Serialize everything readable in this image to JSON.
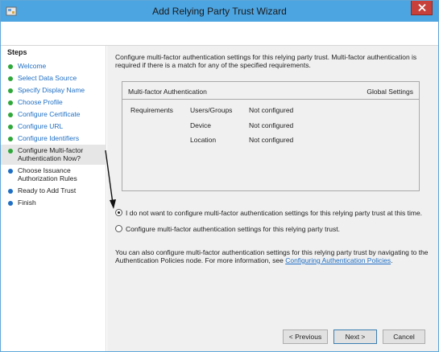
{
  "window": {
    "title": "Add Relying Party Trust Wizard"
  },
  "steps": {
    "heading": "Steps",
    "items": [
      {
        "label": "Welcome",
        "state": "done"
      },
      {
        "label": "Select Data Source",
        "state": "done"
      },
      {
        "label": "Specify Display Name",
        "state": "done"
      },
      {
        "label": "Choose Profile",
        "state": "done"
      },
      {
        "label": "Configure Certificate",
        "state": "done"
      },
      {
        "label": "Configure URL",
        "state": "done"
      },
      {
        "label": "Configure Identifiers",
        "state": "done"
      },
      {
        "label": "Configure Multi-factor Authentication Now?",
        "state": "current"
      },
      {
        "label": "Choose Issuance Authorization Rules",
        "state": "pending"
      },
      {
        "label": "Ready to Add Trust",
        "state": "pending"
      },
      {
        "label": "Finish",
        "state": "pending"
      }
    ]
  },
  "content": {
    "intro": "Configure multi-factor authentication settings for this relying party trust. Multi-factor authentication is required if there is a match for any of the specified requirements.",
    "mfa_box": {
      "title": "Multi-factor Authentication",
      "global_settings": "Global Settings",
      "requirements_label": "Requirements",
      "rows": [
        {
          "key": "Users/Groups",
          "value": "Not configured"
        },
        {
          "key": "Device",
          "value": "Not configured"
        },
        {
          "key": "Location",
          "value": "Not configured"
        }
      ]
    },
    "options": {
      "no_configure": "I do not want to configure multi-factor authentication settings for this relying party trust at this time.",
      "configure": "Configure multi-factor authentication settings for this relying party trust.",
      "selected": "no_configure"
    },
    "note_text": "You can also configure multi-factor authentication settings for this relying party trust by navigating to the Authentication Policies node. For more information, see ",
    "note_link": "Configuring Authentication Policies",
    "note_end": "."
  },
  "buttons": {
    "previous": "< Previous",
    "next": "Next >",
    "cancel": "Cancel"
  },
  "colors": {
    "titlebar": "#4ca4e0",
    "link": "#1f6fc4",
    "done_dot": "#2fa83a",
    "close": "#c7413a"
  }
}
